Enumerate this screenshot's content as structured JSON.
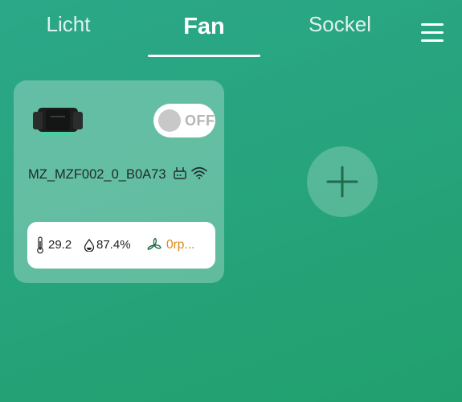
{
  "tabs": [
    {
      "label": "Licht"
    },
    {
      "label": "Fan",
      "active": true
    },
    {
      "label": "Sockel"
    }
  ],
  "menu_icon": "hamburger-menu-icon",
  "colors": {
    "accent_orange": "#d98a1c",
    "icon_green": "#1f6b4a"
  },
  "device": {
    "name": "MZ_MZF002_0_B0A73",
    "toggle_label": "OFF",
    "power_on": false,
    "icons": [
      "fan-device-image",
      "router-icon",
      "wifi-icon"
    ],
    "sensors": {
      "temperature": "29.2",
      "humidity": "87.4%",
      "fan_speed": "0rp..."
    },
    "sensor_icons": [
      "thermometer-icon",
      "humidity-drop-icon",
      "fan-icon"
    ]
  },
  "add_button_icon": "plus-icon"
}
